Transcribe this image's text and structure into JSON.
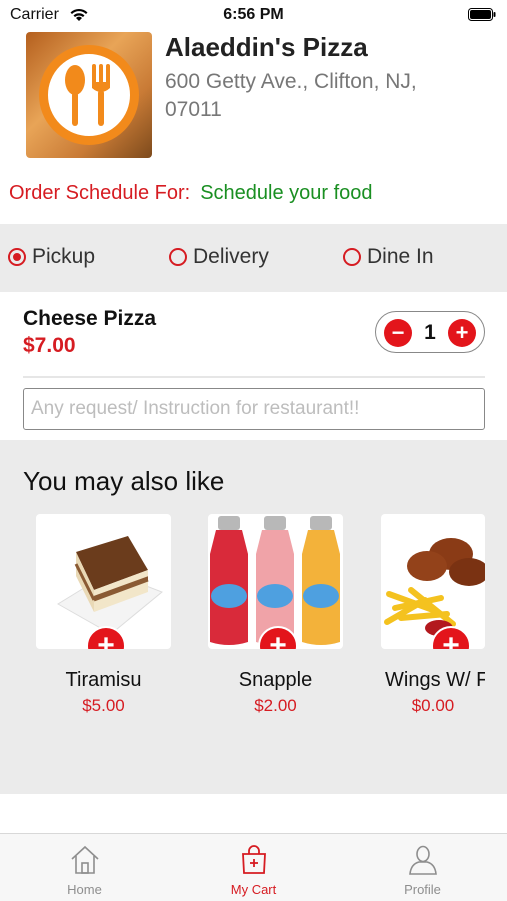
{
  "status_bar": {
    "carrier": "Carrier",
    "time": "6:56 PM"
  },
  "restaurant": {
    "name": "Alaeddin's Pizza",
    "address": "600 Getty Ave., Clifton, NJ, 07011"
  },
  "schedule": {
    "label": "Order Schedule For:",
    "value": "Schedule your food"
  },
  "order_types": [
    {
      "label": "Pickup",
      "selected": true
    },
    {
      "label": "Delivery",
      "selected": false
    },
    {
      "label": "Dine In",
      "selected": false
    }
  ],
  "cart_item": {
    "name": "Cheese Pizza",
    "price": "$7.00",
    "quantity": "1",
    "minus": "−",
    "plus": "+"
  },
  "instructions": {
    "placeholder": "Any request/ Instruction for restaurant!!",
    "value": ""
  },
  "also_like": {
    "title": "You may also like",
    "add_symbol": "+",
    "items": [
      {
        "name": "Tiramisu",
        "price": "$5.00"
      },
      {
        "name": "Snapple",
        "price": "$2.00"
      },
      {
        "name": "Wings W/ F",
        "price": "$0.00"
      }
    ]
  },
  "tabs": [
    {
      "label": "Home",
      "icon": "home-icon",
      "active": false
    },
    {
      "label": "My Cart",
      "icon": "cart-icon",
      "active": true
    },
    {
      "label": "Profile",
      "icon": "profile-icon",
      "active": false
    }
  ],
  "colors": {
    "accent": "#e3151b",
    "schedule_value": "#1a8f22",
    "section_bg": "#ebebeb",
    "logo_orange": "#f28a1b"
  }
}
